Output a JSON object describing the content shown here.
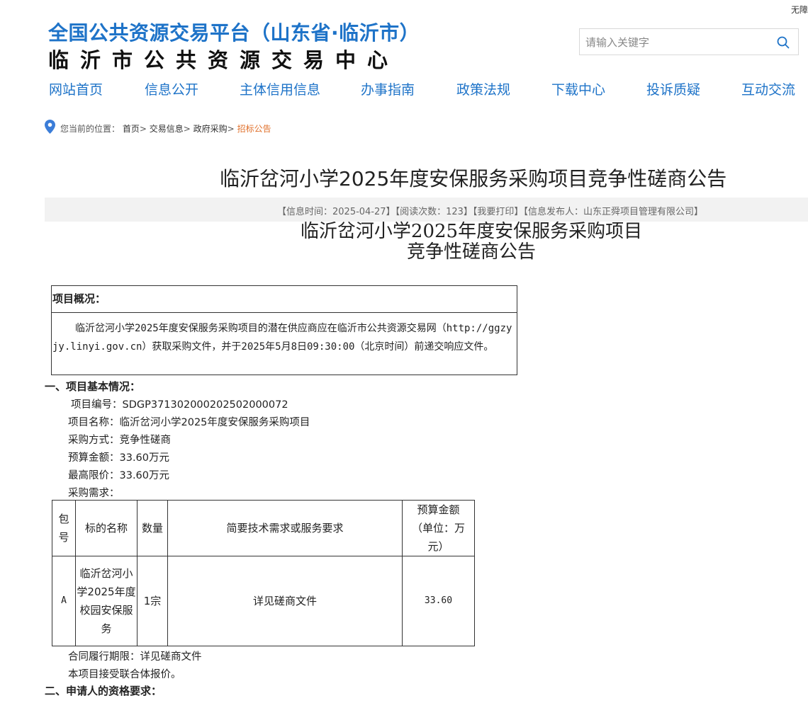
{
  "top_bar": {
    "accessibility_link": "无障"
  },
  "header": {
    "site_title": "全国公共资源交易平台（山东省·临沂市）",
    "site_subtitle": "临沂市公共资源交易中心"
  },
  "search": {
    "placeholder": "请输入关键字",
    "value": "",
    "icon": "search-icon"
  },
  "nav": {
    "items": [
      {
        "label": "网站首页"
      },
      {
        "label": "信息公开"
      },
      {
        "label": "主体信用信息"
      },
      {
        "label": "办事指南"
      },
      {
        "label": "政策法规"
      },
      {
        "label": "下载中心"
      },
      {
        "label": "投诉质疑"
      },
      {
        "label": "互动交流"
      }
    ]
  },
  "breadcrumb": {
    "prefix": "您当前的位置：",
    "items": [
      {
        "label": "首页"
      },
      {
        "label": "交易信息"
      },
      {
        "label": "政府采购"
      },
      {
        "label": "招标公告"
      }
    ],
    "separator": ">"
  },
  "article": {
    "title": "临沂岔河小学2025年度安保服务采购项目竞争性磋商公告",
    "meta": {
      "time_label": "【信息时间：",
      "time": "2025-04-27",
      "reads_label": "】【阅读次数：",
      "reads": "123",
      "print": "】【我要打印】",
      "publisher_label": "【信息发布人：",
      "publisher": "山东正舜项目管理有限公司",
      "end": "】"
    }
  },
  "document": {
    "title_line1": "临沂岔河小学2025年度安保服务采购项目",
    "title_line2": "竞争性磋商公告",
    "overview_heading": "项目概况：",
    "overview_text": "临沂岔河小学2025年度安保服务采购项目的潜在供应商应在临沂市公共资源交易网（http://ggzyjy.linyi.gov.cn）获取采购文件，并于2025年5月8日09:30:00（北京时间）前递交响应文件。",
    "section1_heading": "一、项目基本情况：",
    "project_no": "项目编号：SDGP371302000202502000072",
    "project_name": "项目名称：临沂岔河小学2025年度安保服务采购项目",
    "procurement_method": "采购方式：竞争性磋商",
    "budget": "预算金额：33.60万元",
    "max_price": "最高限价：33.60万元",
    "requirements_label": "采购需求：",
    "table": {
      "headers": [
        "包号",
        "标的名称",
        "数量",
        "简要技术需求或服务要求",
        "预算金额（单位：万元）"
      ],
      "rows": [
        {
          "package": "A",
          "name": "临沂岔河小学2025年度校园安保服务",
          "qty": "1宗",
          "req": "详见磋商文件",
          "budget": "33.60"
        }
      ]
    },
    "contract_period": "合同履行期限：详见磋商文件",
    "joint_bid": "本项目接受联合体报价。",
    "section2_heading": "二、申请人的资格要求："
  }
}
